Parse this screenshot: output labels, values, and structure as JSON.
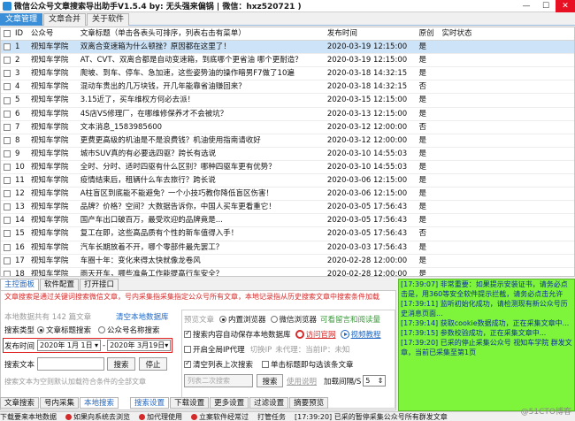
{
  "window": {
    "title": "微信公众号文章搜索导出助手V1.5.4    by: 无头强来偏锅 | 微信：hxz520721 )",
    "minimize": "—",
    "maximize": "☐",
    "close": "✕"
  },
  "tabs": [
    {
      "label": "文章管理"
    },
    {
      "label": "文章合并"
    },
    {
      "label": "关于软件"
    }
  ],
  "table": {
    "headers": {
      "id": "ID",
      "account": "公众号",
      "title": "文章标题（单击各表头可排序，列表右击有菜单）",
      "time": "发布时间",
      "original": "原创",
      "status": "实时状态"
    },
    "rows": [
      {
        "id": "1",
        "account": "视知车学院",
        "title": "双离合变速箱为什么顿挫？原因都在这里了！",
        "time": "2020-03-19 12:15:00",
        "original": "是"
      },
      {
        "id": "2",
        "account": "视知车学院",
        "title": "AT、CVT、双离合都是自动变速箱，到底哪个更省油 哪个更耐造？",
        "time": "2020-03-19 12:15:00",
        "original": "是"
      },
      {
        "id": "3",
        "account": "视知车学院",
        "title": "爬坡、到车、停车、急加速，这些姿势油的操作暗男F7做了10遍",
        "time": "2020-03-18 14:32:15",
        "original": "是"
      },
      {
        "id": "4",
        "account": "视知车学院",
        "title": "混动车贵出的几万块钱，开几年能靠省油赚回来？",
        "time": "2020-03-18 14:32:15",
        "original": "否"
      },
      {
        "id": "5",
        "account": "视知车学院",
        "title": "3.15近了，买车维权方何必去派！",
        "time": "2020-03-15 12:15:00",
        "original": "是"
      },
      {
        "id": "6",
        "account": "视知车学院",
        "title": "4S店VS修理厂，在哪维修保养才不会被坑？",
        "time": "2020-03-13 12:15:00",
        "original": "是"
      },
      {
        "id": "7",
        "account": "视知车学院",
        "title": "文本消息_1583985600",
        "time": "2020-03-12 12:00:00",
        "original": "否"
      },
      {
        "id": "8",
        "account": "视知车学院",
        "title": "更费更高级的机油是不是浪费钱？机油使用指南请收好",
        "time": "2020-03-12 12:00:00",
        "original": "是"
      },
      {
        "id": "9",
        "account": "视知车学院",
        "title": "城市SUV真的有必要选四驱？跨长有选说",
        "time": "2020-03-10 14:55:03",
        "original": "是"
      },
      {
        "id": "10",
        "account": "视知车学院",
        "title": "全时、分时、适时四驱有什么区别？哪种四驱车更有优势？",
        "time": "2020-03-10 14:55:03",
        "original": "是"
      },
      {
        "id": "11",
        "account": "视知车学院",
        "title": "疫情结束后，租辆什么车去旅行？跨长说",
        "time": "2020-03-06 12:15:00",
        "original": "是"
      },
      {
        "id": "12",
        "account": "视知车学院",
        "title": "A柱盲区到底能不能避免？一个小技巧教你降低盲区伤害！",
        "time": "2020-03-06 12:15:00",
        "original": "是"
      },
      {
        "id": "13",
        "account": "视知车学院",
        "title": "品牌？价格？空间？大数据告诉你，中国人买车更看重它！",
        "time": "2020-03-05 17:56:43",
        "original": "是"
      },
      {
        "id": "14",
        "account": "视知车学院",
        "title": "国产车出口破百万，最受欢迎的品牌竟是...",
        "time": "2020-03-05 17:56:43",
        "original": "是"
      },
      {
        "id": "15",
        "account": "视知车学院",
        "title": "复工在即，这些高品质有个性的新车值得入手！",
        "time": "2020-03-05 17:56:43",
        "original": "否"
      },
      {
        "id": "16",
        "account": "视知车学院",
        "title": "汽车长期放着不开，哪个零部件最先罢工？",
        "time": "2020-03-03 17:56:43",
        "original": "是"
      },
      {
        "id": "17",
        "account": "视知车学院",
        "title": "车圈十年：变化来得太快就像龙卷风",
        "time": "2020-02-28 12:00:00",
        "original": "是"
      },
      {
        "id": "18",
        "account": "视知车学院",
        "title": "雨天开车，哪些准备工作能提高行车安全？",
        "time": "2020-02-28 12:00:00",
        "original": "是"
      }
    ]
  },
  "lower_tabs": [
    {
      "label": "主控面板"
    },
    {
      "label": "软件配置"
    },
    {
      "label": "打开接口"
    }
  ],
  "panel": {
    "notice": "文章搜索是通过关键词搜索微信文章，号内采集指采集指定公众号所有文章，本地记录指从历史搜索文章中搜索条件加载",
    "data_count": "本地数据共有 142 篇文章",
    "clear_btn": "清空本地数据库",
    "search_type_label": "搜索类型",
    "search_type_opt1": "文章标题搜索",
    "search_type_opt2": "公众号名称搜索",
    "publish_time_label": "发布时间",
    "date_from": "2020年 1月 1日",
    "date_to": "2020年 3月19日",
    "search_text_label": "搜索文本",
    "search_btn": "搜索",
    "stop_btn": "停止",
    "search_hint": "搜索文本为空则默认加载符合条件的全部文章",
    "preview_label": "预览文章",
    "browser_builtin": "内置浏览器",
    "browser_wechat": "微信浏览器",
    "view_comments": "可看留言和阅读量",
    "auto_save": "搜索内容自动保存本地数据库",
    "visit_official": "访问官网",
    "video_tutorial": "视频教程",
    "enable_ip_proxy": "开启全局IP代理",
    "switch_ip": "切换IP",
    "unused_proxy": "未代理：当前IP：未知",
    "clear_last": "清空列表上次搜索",
    "click_preview": "单击标题即勾选该条文章",
    "list_placeholder": "列表二次搜索",
    "list_search_btn": "搜索",
    "usage_help": "使用说明",
    "load_speed_label": "加载间隔/S",
    "load_speed_value": "5"
  },
  "sub_tabs_left": [
    {
      "label": "文章搜索"
    },
    {
      "label": "号内采集"
    },
    {
      "label": "本地搜索"
    }
  ],
  "sub_tabs_right": [
    {
      "label": "搜索设置"
    },
    {
      "label": "下载设置"
    },
    {
      "label": "更多设置"
    },
    {
      "label": "过滤设置"
    },
    {
      "label": "摘要预览"
    }
  ],
  "log": [
    "[17:39:07] 非常重要：如果提示安装证书，请务必点击是，用360等安全软件提示拦截，请务必点击允许",
    "[17:39:11] 监听初始化成功，请检测现有新公众号历史消息页面...",
    "[17:39:14] 获取cookie数据成功，正在采集文章中...",
    "[17:39:15] 参数校验成功，正在采集文章中...",
    "[17:39:20] 已采的停止采集公众号 视知车学院 群发文章，当前已采集至第1页"
  ],
  "statusbar": {
    "items": [
      "下载要来本地数据",
      "如果向系统去浏览",
      "加代理使用",
      "立案软件经常过",
      "打管任务",
      "[17:39:20] 已采的暂停采集公众号所有群发文章"
    ]
  },
  "watermark": "@51CTO博客"
}
